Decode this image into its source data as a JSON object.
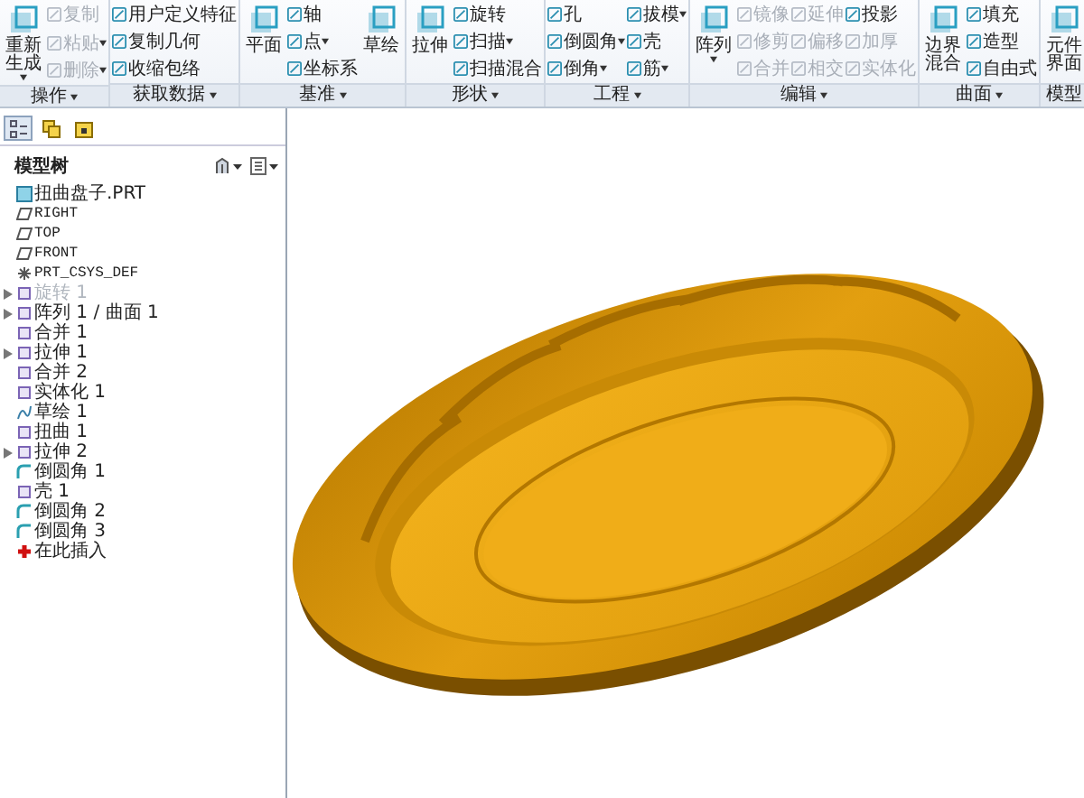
{
  "ribbon": {
    "groups": [
      {
        "label": "操作",
        "dropdown": true,
        "columns": [
          {
            "kind": "large",
            "label": "重新生成",
            "dropdown": true,
            "disabled": false
          },
          {
            "kind": "stack",
            "items": [
              {
                "label": "复制",
                "dropdown": false,
                "disabled": true
              },
              {
                "label": "粘贴",
                "dropdown": true,
                "disabled": true
              },
              {
                "label": "删除",
                "dropdown": true,
                "disabled": true
              }
            ]
          }
        ]
      },
      {
        "label": "获取数据",
        "dropdown": true,
        "columns": [
          {
            "kind": "stack",
            "items": [
              {
                "label": "用户定义特征",
                "dropdown": false,
                "disabled": false
              },
              {
                "label": "复制几何",
                "dropdown": false,
                "disabled": false
              },
              {
                "label": "收缩包络",
                "dropdown": false,
                "disabled": false
              }
            ]
          }
        ]
      },
      {
        "label": "基准",
        "dropdown": true,
        "columns": [
          {
            "kind": "large",
            "label": "平面",
            "dropdown": false,
            "disabled": false
          },
          {
            "kind": "stack",
            "items": [
              {
                "label": "轴",
                "dropdown": false,
                "disabled": false
              },
              {
                "label": "点",
                "dropdown": true,
                "disabled": false
              },
              {
                "label": "坐标系",
                "dropdown": false,
                "disabled": false
              }
            ]
          },
          {
            "kind": "large",
            "label": "草绘",
            "dropdown": false,
            "disabled": false
          }
        ]
      },
      {
        "label": "形状",
        "dropdown": true,
        "columns": [
          {
            "kind": "large",
            "label": "拉伸",
            "dropdown": false,
            "disabled": false
          },
          {
            "kind": "stack",
            "items": [
              {
                "label": "旋转",
                "dropdown": false,
                "disabled": false
              },
              {
                "label": "扫描",
                "dropdown": true,
                "disabled": false
              },
              {
                "label": "扫描混合",
                "dropdown": false,
                "disabled": false
              }
            ]
          }
        ]
      },
      {
        "label": "工程",
        "dropdown": true,
        "columns": [
          {
            "kind": "stack",
            "items": [
              {
                "label": "孔",
                "dropdown": false,
                "disabled": false
              },
              {
                "label": "倒圆角",
                "dropdown": true,
                "disabled": false
              },
              {
                "label": "倒角",
                "dropdown": true,
                "disabled": false
              }
            ]
          },
          {
            "kind": "stack",
            "items": [
              {
                "label": "拔模",
                "dropdown": true,
                "disabled": false
              },
              {
                "label": "壳",
                "dropdown": false,
                "disabled": false
              },
              {
                "label": "筋",
                "dropdown": true,
                "disabled": false
              }
            ]
          }
        ]
      },
      {
        "label": "编辑",
        "dropdown": true,
        "columns": [
          {
            "kind": "large",
            "label": "阵列",
            "dropdown": true,
            "disabled": false
          },
          {
            "kind": "stack",
            "items": [
              {
                "label": "镜像",
                "dropdown": false,
                "disabled": true
              },
              {
                "label": "修剪",
                "dropdown": false,
                "disabled": true
              },
              {
                "label": "合并",
                "dropdown": false,
                "disabled": true
              }
            ]
          },
          {
            "kind": "stack",
            "items": [
              {
                "label": "延伸",
                "dropdown": false,
                "disabled": true
              },
              {
                "label": "偏移",
                "dropdown": false,
                "disabled": true
              },
              {
                "label": "相交",
                "dropdown": false,
                "disabled": true
              }
            ]
          },
          {
            "kind": "stack",
            "items": [
              {
                "label": "投影",
                "dropdown": false,
                "disabled": false
              },
              {
                "label": "加厚",
                "dropdown": false,
                "disabled": true
              },
              {
                "label": "实体化",
                "dropdown": false,
                "disabled": true
              }
            ]
          }
        ]
      },
      {
        "label": "曲面",
        "dropdown": true,
        "columns": [
          {
            "kind": "large",
            "label": "边界混合",
            "dropdown": false,
            "disabled": false
          },
          {
            "kind": "stack",
            "items": [
              {
                "label": "填充",
                "dropdown": false,
                "disabled": false
              },
              {
                "label": "造型",
                "dropdown": false,
                "disabled": false
              },
              {
                "label": "自由式",
                "dropdown": false,
                "disabled": false
              }
            ]
          }
        ]
      },
      {
        "label": "模型",
        "dropdown": false,
        "columns": [
          {
            "kind": "large",
            "label": "元件界面",
            "dropdown": false,
            "disabled": false
          }
        ]
      }
    ]
  },
  "navigator_tabs": [
    {
      "selected": true
    },
    {
      "selected": false
    },
    {
      "selected": false
    }
  ],
  "model_tree": {
    "title": "模型树",
    "items": [
      {
        "label": "扭曲盘子.PRT",
        "kind": "part",
        "collapsed": false,
        "disabled": false
      },
      {
        "label": "RIGHT",
        "kind": "plane",
        "collapsed": false,
        "disabled": false
      },
      {
        "label": "TOP",
        "kind": "plane",
        "collapsed": false,
        "disabled": false
      },
      {
        "label": "FRONT",
        "kind": "plane",
        "collapsed": false,
        "disabled": false
      },
      {
        "label": "PRT_CSYS_DEF",
        "kind": "csys",
        "collapsed": false,
        "disabled": false
      },
      {
        "label": "旋转 1",
        "kind": "feature",
        "collapsed": true,
        "disabled": true
      },
      {
        "label": "阵列 1 / 曲面 1",
        "kind": "feature",
        "collapsed": true,
        "disabled": false
      },
      {
        "label": "合并 1",
        "kind": "feature",
        "collapsed": false,
        "disabled": false
      },
      {
        "label": "拉伸 1",
        "kind": "feature",
        "collapsed": true,
        "disabled": false
      },
      {
        "label": "合并 2",
        "kind": "feature",
        "collapsed": false,
        "disabled": false
      },
      {
        "label": "实体化 1",
        "kind": "feature",
        "collapsed": false,
        "disabled": false
      },
      {
        "label": "草绘 1",
        "kind": "sketch",
        "collapsed": false,
        "disabled": false
      },
      {
        "label": "扭曲 1",
        "kind": "feature",
        "collapsed": false,
        "disabled": false
      },
      {
        "label": "拉伸 2",
        "kind": "feature",
        "collapsed": true,
        "disabled": false
      },
      {
        "label": "倒圆角 1",
        "kind": "round",
        "collapsed": false,
        "disabled": false
      },
      {
        "label": "壳 1",
        "kind": "feature",
        "collapsed": false,
        "disabled": false
      },
      {
        "label": "倒圆角 2",
        "kind": "round",
        "collapsed": false,
        "disabled": false
      },
      {
        "label": "倒圆角 3",
        "kind": "round",
        "collapsed": false,
        "disabled": false
      },
      {
        "label": "在此插入",
        "kind": "insert",
        "collapsed": false,
        "disabled": false
      }
    ]
  }
}
